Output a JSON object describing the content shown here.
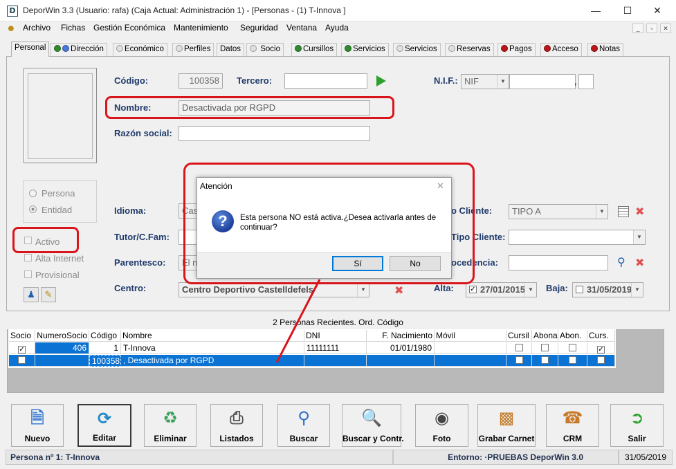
{
  "window": {
    "app_icon": "D",
    "title": "DeporWin 3.3  (Usuario: rafa)  (Caja Actual: Administración 1) - [Personas - (1) T-Innova  ]",
    "minimize": "—",
    "maximize": "☐",
    "close": "✕"
  },
  "menu": {
    "items": [
      "Archivo",
      "Fichas",
      "Gestión Económica",
      "Mantenimiento",
      "Seguridad",
      "Ventana",
      "Ayuda"
    ],
    "mdi": [
      "_",
      "▫",
      "✕"
    ]
  },
  "tabs": [
    "Personal",
    "Dirección",
    "Económico",
    "Perfiles",
    "Datos",
    "Socio",
    "Cursillos",
    "Servicios",
    "Servicios",
    "Reservas",
    "Pagos",
    "Acceso",
    "Notas"
  ],
  "form": {
    "codigo_label": "Código:",
    "codigo_value": "100358",
    "tercero_label": "Tercero:",
    "tercero_value": "",
    "nif_label": "N.I.F.:",
    "nif_type": "NIF",
    "nif_value": "",
    "nif_sep": ",",
    "nombre_label": "Nombre:",
    "nombre_value": "Desactivada por RGPD",
    "razon_label": "Razón social:",
    "razon_value": "",
    "radio_persona": "Persona",
    "radio_entidad": "Entidad",
    "idioma_label": "Idioma:",
    "idioma_value": "Cas",
    "tutor_label": "Tutor/C.Fam:",
    "parentesco_label": "Parentesco:",
    "parentesco_value": "El n",
    "centro_label": "Centro:",
    "centro_value": "Centro Deportivo Castelldefels",
    "activo_label": "Activo",
    "alta_internet_label": "Alta Internet",
    "provisional_label": "Provisional",
    "tipo_cliente_label": "o Cliente:",
    "tipo_cliente_value": "TIPO A",
    "subtipo_label": "Tipo Cliente:",
    "procedencia_label": "ocedencia:",
    "alta_label": "Alta:",
    "alta_value": "27/01/2015",
    "baja_label": "Baja:",
    "baja_value": "31/05/2019"
  },
  "grid": {
    "title": "2 Personas Recientes. Ord. Código",
    "headers": [
      "Socio",
      "NumeroSocio",
      "Código",
      "Nombre",
      "DNI",
      "F. Nacimiento",
      "Móvil",
      "Cursil",
      "Abona",
      "Abon.",
      "Curs."
    ],
    "rows": [
      {
        "socio": true,
        "numero": "406",
        "codigo": "1",
        "nombre": "T-Innova",
        "dni": "11111111",
        "fnac": "01/01/1980",
        "movil": "",
        "cursil": false,
        "abona": false,
        "abon": false,
        "curs": true
      },
      {
        "socio": false,
        "numero": "",
        "codigo": "100358",
        "nombre": ", Desactivada por RGPD",
        "dni": "",
        "fnac": "",
        "movil": "",
        "cursil": false,
        "abona": false,
        "abon": false,
        "curs": false
      }
    ]
  },
  "toolbar": [
    "Nuevo",
    "Editar",
    "Eliminar",
    "Listados",
    "Buscar",
    "Buscar y Contr.",
    "Foto",
    "Grabar Carnet",
    "CRM",
    "Salir"
  ],
  "status": {
    "left": "Persona nº 1: T-Innova",
    "center": "Entorno: ·PRUEBAS DeporWin 3.0",
    "date": "31/05/2019"
  },
  "dialog": {
    "title": "Atención",
    "close": "✕",
    "message": "Esta persona NO está activa.¿Desea activarla antes de continuar?",
    "yes": "Sí",
    "no": "No"
  },
  "colors": {
    "accent_red": "#d9151c",
    "selection_blue": "#0b73d4",
    "label_blue": "#1f3a6b"
  }
}
